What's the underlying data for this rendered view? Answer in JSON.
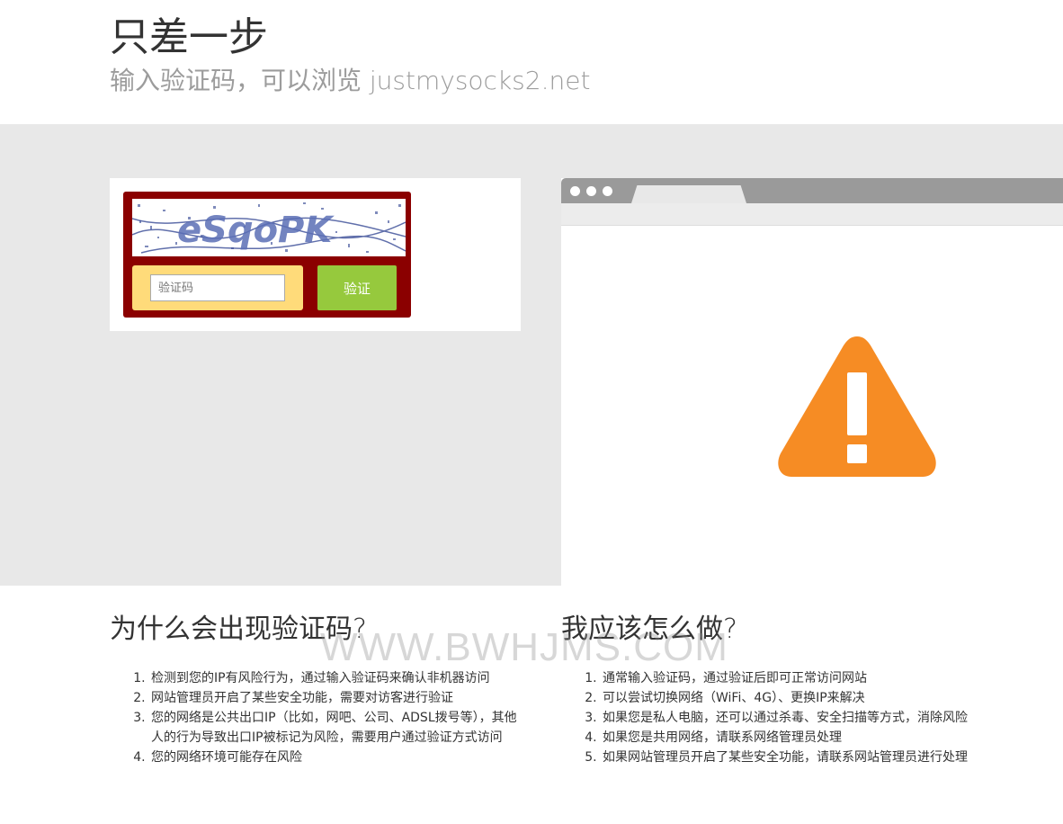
{
  "header": {
    "title": "只差一步",
    "subtitle": "输入验证码，可以浏览 justmysocks2.net"
  },
  "captcha": {
    "image_text": "eSqoPK",
    "input_placeholder": "验证码",
    "input_value": "",
    "verify_label": "验证"
  },
  "browser_mock": {
    "warning_icon": "warning-triangle-icon",
    "warning_color": "#f68c24"
  },
  "why": {
    "title": "为什么会出现验证码?",
    "items": [
      "检测到您的IP有风险行为，通过输入验证码来确认非机器访问",
      "网站管理员开启了某些安全功能，需要对访客进行验证",
      "您的网络是公共出口IP（比如，网吧、公司、ADSL拨号等），其他人的行为导致出口IP被标记为风险，需要用户通过验证方式访问",
      "您的网络环境可能存在风险"
    ]
  },
  "what": {
    "title": "我应该怎么做?",
    "items": [
      "通常输入验证码，通过验证后即可正常访问网站",
      "可以尝试切换网络（WiFi、4G）、更换IP来解决",
      "如果您是私人电脑，还可以通过杀毒、安全扫描等方式，消除风险",
      "如果您是共用网络，请联系网络管理员处理",
      "如果网站管理员开启了某些安全功能，请联系网站管理员进行处理"
    ]
  },
  "watermark": "WWW.BWHJMS.COM",
  "colors": {
    "captcha_frame": "#8b0000",
    "input_wrap": "#ffdb7a",
    "verify_button": "#96c93d",
    "band": "#e8e8e8"
  }
}
